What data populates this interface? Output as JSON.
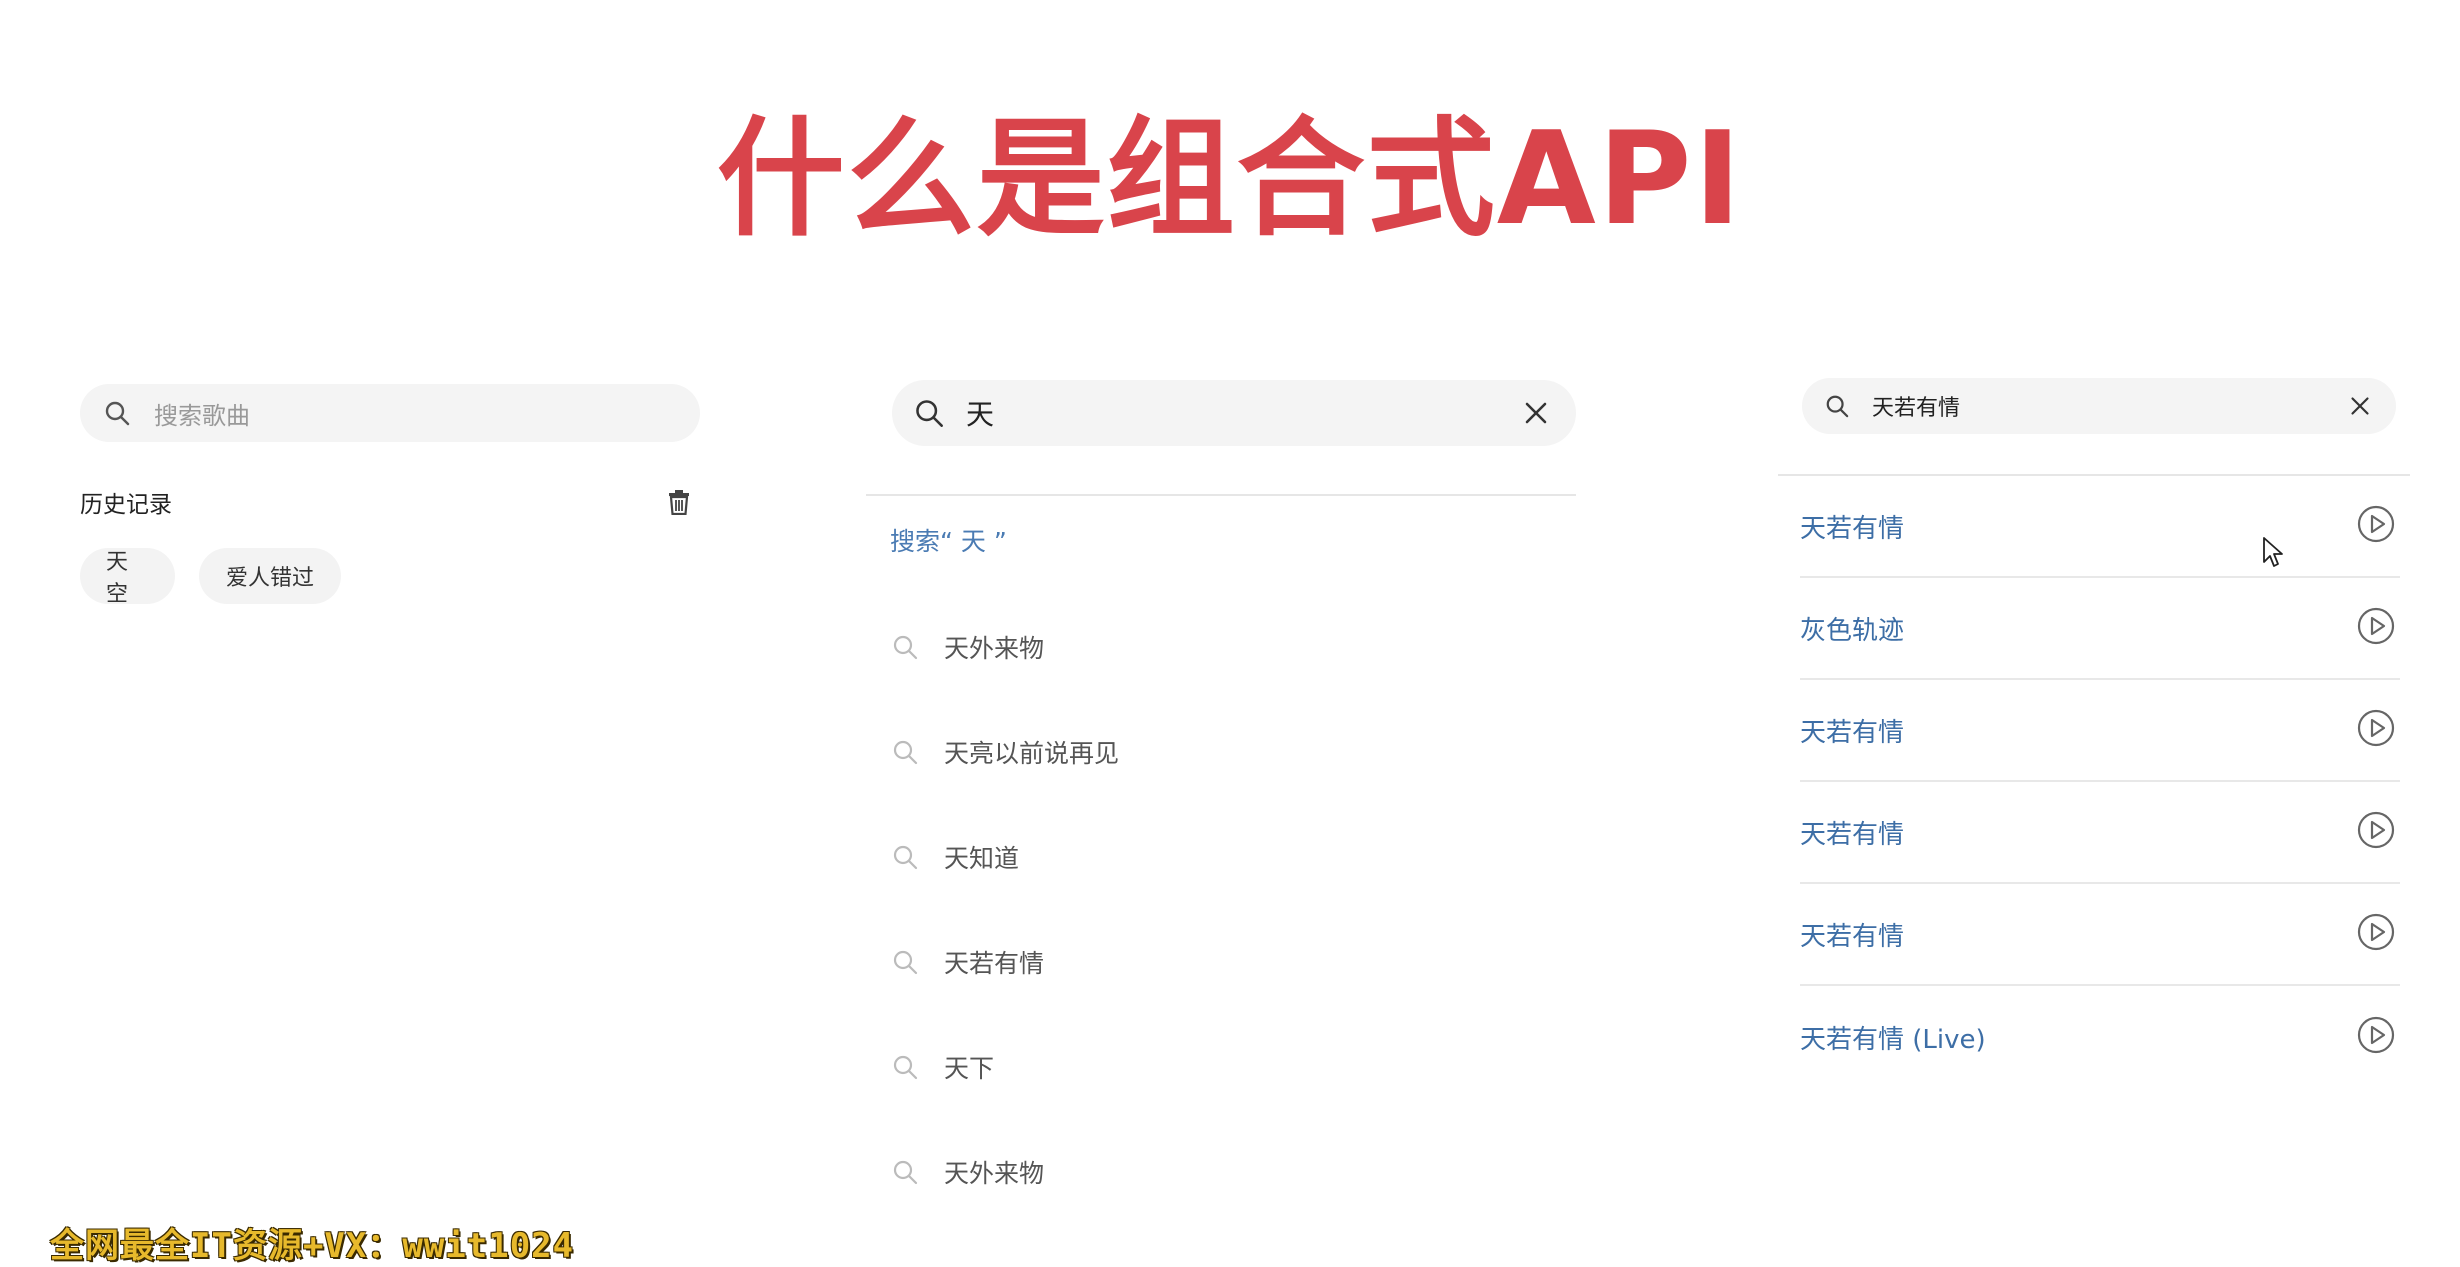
{
  "title": "什么是组合式API",
  "panel1": {
    "search": {
      "placeholder": "搜索歌曲",
      "icon": "search-icon"
    },
    "history_title": "历史记录",
    "delete_icon": "trash-icon",
    "tags": [
      "天空",
      "爱人错过"
    ]
  },
  "panel2": {
    "search": {
      "value": "天",
      "icon": "search-icon",
      "clear_icon": "close-icon"
    },
    "search_suggestion": "搜索“ 天 ”",
    "suggestions": [
      "天外来物",
      "天亮以前说再见",
      "天知道",
      "天若有情",
      "天下",
      "天外来物"
    ]
  },
  "panel3": {
    "search": {
      "value": "天若有情",
      "icon": "search-icon",
      "clear_icon": "close-icon"
    },
    "results": [
      "天若有情",
      "灰色轨迹",
      "天若有情",
      "天若有情",
      "天若有情",
      "天若有情 (Live)"
    ],
    "play_icon": "play-circle-icon"
  },
  "watermark": "全网最全IT资源+VX：wwit1024",
  "colors": {
    "title": "#d9444b",
    "link": "#3d6ea6",
    "watermark": "#e7b92c"
  }
}
